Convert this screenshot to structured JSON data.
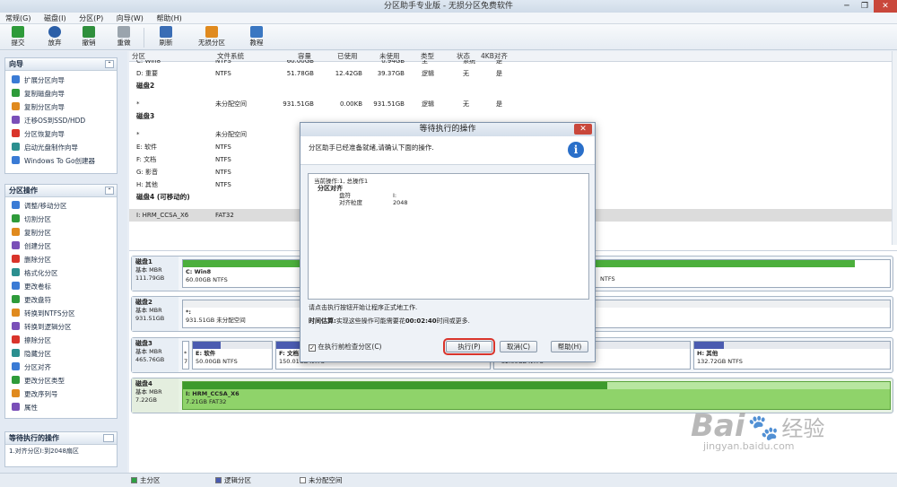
{
  "window": {
    "title": "分区助手专业版 - 无损分区免费软件",
    "controls": [
      "─",
      "❐",
      "✕"
    ]
  },
  "menu": [
    "常规(G)",
    "磁盘(I)",
    "分区(P)",
    "向导(W)",
    "帮助(H)"
  ],
  "toolbar": {
    "buttons": [
      {
        "label": "提交",
        "icon": "check-icon",
        "color": "#2e9b3a"
      },
      {
        "label": "放弃",
        "icon": "discard-icon",
        "color": "#2b5fa8"
      },
      {
        "label": "撤销",
        "icon": "undo-icon",
        "color": "#2f8f3c"
      },
      {
        "label": "重做",
        "icon": "redo-icon",
        "color": "#9aa4ad"
      },
      {
        "label": "刷新",
        "icon": "refresh-icon",
        "color": "#3a6db5"
      },
      {
        "label": "无损分区",
        "icon": "lossless-partition-icon",
        "color": "#e08a1e"
      },
      {
        "label": "教程",
        "icon": "tutorial-icon",
        "color": "#3a77c2"
      }
    ]
  },
  "sidebar": {
    "wizard": {
      "title": "向导",
      "items": [
        "扩展分区向导",
        "复制磁盘向导",
        "复制分区向导",
        "迁移OS到SSD/HDD",
        "分区恢复向导",
        "启动光盘制作向导",
        "Windows To Go创建器"
      ]
    },
    "partition_ops": {
      "title": "分区操作",
      "items": [
        "调整/移动分区",
        "切割分区",
        "复制分区",
        "创建分区",
        "删除分区",
        "格式化分区",
        "更改卷标",
        "更改盘符",
        "转换到NTFS分区",
        "转换到逻辑分区",
        "擦除分区",
        "隐藏分区",
        "分区对齐",
        "更改分区类型",
        "更改序列号",
        "属性"
      ]
    },
    "pending": {
      "title": "等待执行的操作",
      "items": [
        "1.对齐分区I:到2048扇区"
      ]
    }
  },
  "list": {
    "columns": [
      "分区",
      "文件系统",
      "容量",
      "已使用",
      "未使用",
      "类型",
      "状态",
      "4KB对齐"
    ],
    "rows": [
      {
        "kind": "row",
        "name": "C: Win8",
        "fs": "NTFS",
        "cap": "60.00GB",
        "used": "",
        "free": "0.94GB",
        "type": "主",
        "status": "系统",
        "align": "是",
        "clip": true
      },
      {
        "kind": "row",
        "name": "D: 重要",
        "fs": "NTFS",
        "cap": "51.78GB",
        "used": "12.42GB",
        "free": "39.37GB",
        "type": "逻辑",
        "status": "无",
        "align": "是"
      },
      {
        "kind": "disk",
        "name": "磁盘2"
      },
      {
        "kind": "row",
        "name": "*",
        "fs": "未分配空间",
        "cap": "931.51GB",
        "used": "0.00KB",
        "free": "931.51GB",
        "type": "逻辑",
        "status": "无",
        "align": "是"
      },
      {
        "kind": "disk",
        "name": "磁盘3"
      },
      {
        "kind": "row",
        "name": "*",
        "fs": "未分配空间",
        "cap": "",
        "used": "",
        "free": "",
        "type": "",
        "status": "",
        "align": ""
      },
      {
        "kind": "row",
        "name": "E: 软件",
        "fs": "NTFS",
        "cap": "50.",
        "used": "",
        "free": "",
        "type": "",
        "status": "",
        "align": ""
      },
      {
        "kind": "row",
        "name": "F: 文档",
        "fs": "NTFS",
        "cap": "150",
        "used": "",
        "free": "",
        "type": "",
        "status": "",
        "align": ""
      },
      {
        "kind": "row",
        "name": "G: 影音",
        "fs": "NTFS",
        "cap": "133.",
        "used": "",
        "free": "",
        "type": "",
        "status": "",
        "align": ""
      },
      {
        "kind": "row",
        "name": "H: 其他",
        "fs": "NTFS",
        "cap": "133.",
        "used": "",
        "free": "",
        "type": "",
        "status": "",
        "align": ""
      },
      {
        "kind": "disk",
        "name": "磁盘4 (可移动的)"
      },
      {
        "kind": "row",
        "name": "I: HRM_CCSA_X6",
        "fs": "FAT32",
        "cap": "7.",
        "used": "",
        "free": "",
        "type": "",
        "status": "",
        "align": "",
        "selected": true
      }
    ]
  },
  "disks": [
    {
      "name": "磁盘1",
      "type": "基本 MBR",
      "size": "111.79GB",
      "partitions": [
        {
          "label": "C: Win8",
          "detail": "60.00GB NTFS",
          "fill": 0.95
        }
      ],
      "right_text": "NTFS"
    },
    {
      "name": "磁盘2",
      "type": "基本 MBR",
      "size": "931.51GB",
      "partitions": [
        {
          "label": "*:",
          "detail": "931.51GB 未分配空间",
          "fill": 0
        }
      ]
    },
    {
      "name": "磁盘3",
      "type": "基本 MBR",
      "size": "465.76GB",
      "small_label": "*",
      "small_detail": "7",
      "partitions": [
        {
          "label": "E: 软件",
          "detail": "50.00GB NTFS",
          "fill": 0.35
        },
        {
          "label": "F: 文档",
          "detail": "150.01GB NTFS",
          "fill": 0.3
        }
      ],
      "mid_detail": "32.00GB NTFS",
      "last": {
        "label": "H: 其他",
        "detail": "132.72GB NTFS",
        "fill": 0.15
      }
    },
    {
      "name": "磁盘4",
      "type": "基本 MBR",
      "size": "7.22GB",
      "partitions": [
        {
          "label": "I: HRM_CCSA_X6",
          "detail": "7.21GB FAT32",
          "fill": 0.6
        }
      ]
    }
  ],
  "legend": [
    {
      "label": "主分区",
      "color": "#2ea043"
    },
    {
      "label": "逻辑分区",
      "color": "#4a5bb0"
    },
    {
      "label": "未分配空间",
      "color": "#ffffff"
    }
  ],
  "dialog": {
    "title": "等待执行的操作",
    "message": "分区助手已经准备就绪,请确认下面的操作.",
    "ops_header": "当前操作:1, 总操作1",
    "op_title": "分区对齐",
    "op_fields": [
      {
        "k": "盘符",
        "v": "I:"
      },
      {
        "k": "对齐粒度",
        "v": "2048"
      }
    ],
    "hint": "请点击执行按钮开始让程序正式地工作.",
    "time_label": "时间估算:",
    "time_text": "实现这些操作可能需要花",
    "time_value": "00:02:40",
    "time_suffix": "时间或更多.",
    "checkbox_label": "在执行前检查分区(C)",
    "buttons": {
      "execute": "执行(P)",
      "cancel": "取消(C)",
      "help": "帮助(H)"
    }
  },
  "watermark": {
    "brand": "Bai",
    "brand2": "经验",
    "url": "jingyan.baidu.com"
  }
}
